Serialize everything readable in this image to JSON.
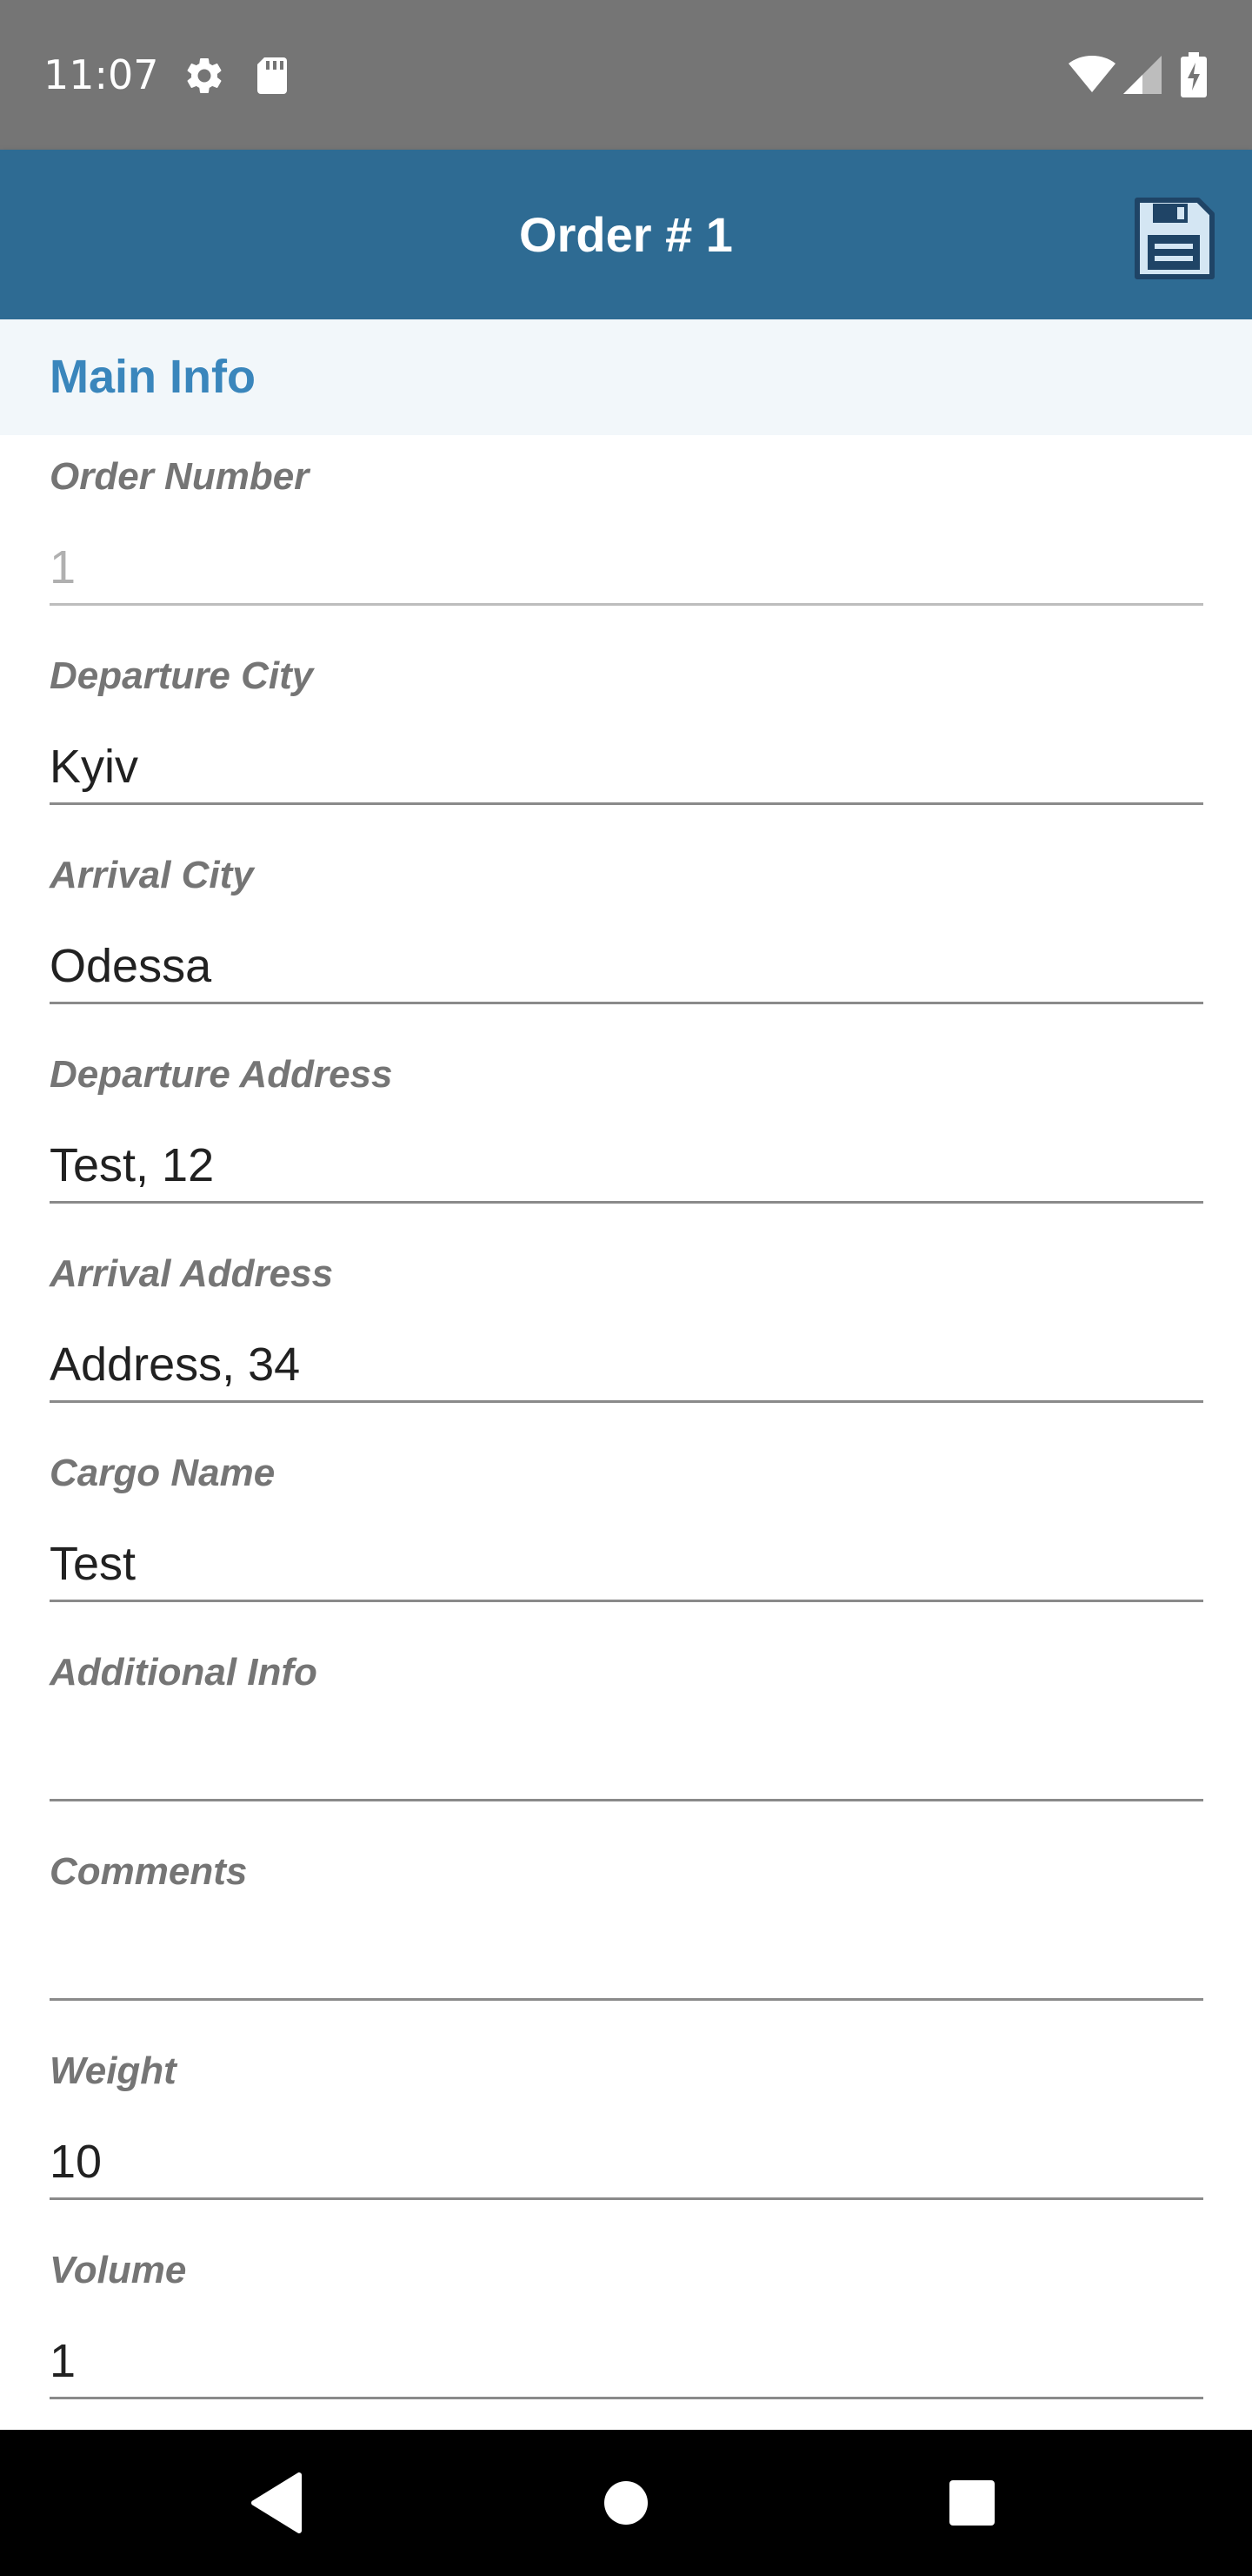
{
  "status_bar": {
    "time": "11:07",
    "icons": [
      "gear-icon",
      "sd-card-icon",
      "wifi-icon",
      "cell-signal-icon",
      "battery-charging-icon"
    ]
  },
  "app_bar": {
    "title": "Order # 1",
    "save_icon": "floppy-disk-icon"
  },
  "section": {
    "title": "Main Info"
  },
  "fields": [
    {
      "label": "Order Number",
      "value": "1",
      "disabled": true
    },
    {
      "label": "Departure City",
      "value": "Kyiv"
    },
    {
      "label": "Arrival City",
      "value": "Odessa"
    },
    {
      "label": "Departure Address",
      "value": "Test, 12"
    },
    {
      "label": "Arrival Address",
      "value": "Address, 34"
    },
    {
      "label": "Cargo Name",
      "value": "Test"
    },
    {
      "label": "Additional Info",
      "value": ""
    },
    {
      "label": "Comments",
      "value": ""
    },
    {
      "label": "Weight",
      "value": "10"
    },
    {
      "label": "Volume",
      "value": "1"
    }
  ],
  "nav_bar": {
    "buttons": [
      "back-icon",
      "home-icon",
      "recents-icon"
    ]
  },
  "colors": {
    "status_bar": "#757575",
    "app_bar": "#2e6b93",
    "accent": "#3a86bc",
    "section_bg": "#f2f7fa"
  }
}
